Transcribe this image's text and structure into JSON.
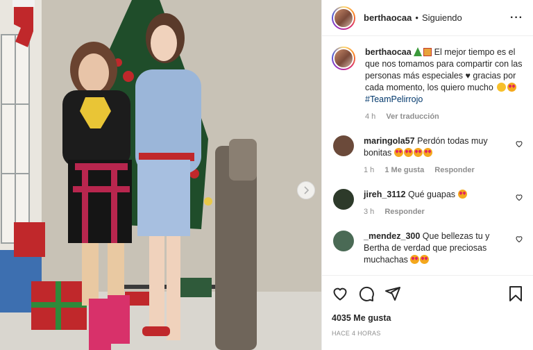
{
  "post": {
    "username": "berthaocaa",
    "separator": "•",
    "follow_status": "Siguiendo",
    "more_icon": "more-horizontal-icon"
  },
  "caption": {
    "username": "berthaocaa",
    "text": "El mejor tiempo es el que nos tomamos para compartir con las personas más especiales ♥ gracias por cada momento, los quiero mucho",
    "hashtag": "#TeamPelirrojo",
    "time": "4 h",
    "translate_label": "Ver traducción"
  },
  "comments": [
    {
      "username": "maringola57",
      "text": "Perdón todas muy bonitas",
      "time": "1 h",
      "likes": "1 Me gusta",
      "reply": "Responder",
      "avatar_color": "#6b4a3a"
    },
    {
      "username": "jireh_3112",
      "text": "Qué guapas",
      "time": "3 h",
      "reply": "Responder",
      "avatar_color": "#2d3a2a"
    },
    {
      "username": "_mendez_300",
      "text": "Que bellezas tu y Bertha de verdad que preciosas muchachas",
      "avatar_color": "#4a6a55"
    }
  ],
  "actions": {
    "like_icon": "heart-icon",
    "comment_icon": "comment-icon",
    "share_icon": "share-icon",
    "save_icon": "bookmark-icon"
  },
  "likes_count": "4035 Me gusta",
  "posted_ago": "HACE 4 HORAS",
  "colors": {
    "hashtag": "#00376b",
    "secondary": "#8e8e8e",
    "text": "#262626"
  }
}
